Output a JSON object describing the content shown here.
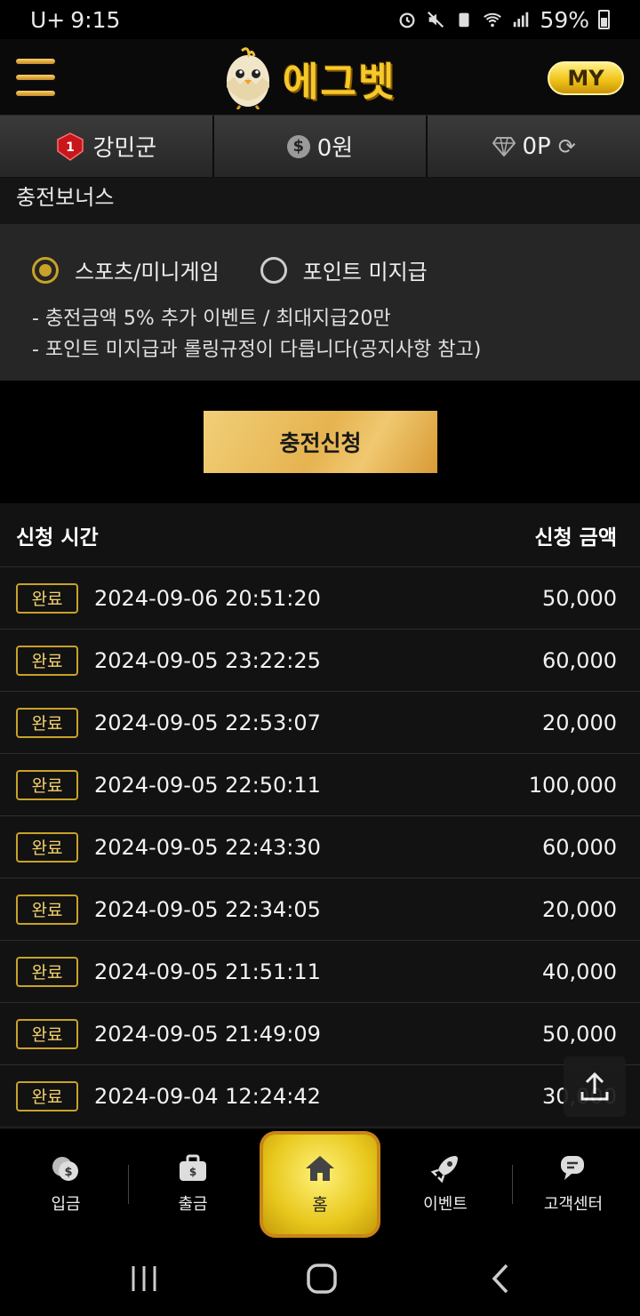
{
  "status_bar": {
    "carrier": "U+",
    "time": "9:15",
    "battery": "59%"
  },
  "header": {
    "logo_text": "에그벳",
    "my_label": "MY"
  },
  "user_bar": {
    "username": "강민군",
    "level": "1",
    "balance": "0원",
    "points": "0P"
  },
  "bonus": {
    "title": "충전보너스",
    "options": [
      {
        "label": "스포츠/미니게임",
        "selected": true
      },
      {
        "label": "포인트 미지급",
        "selected": false
      }
    ],
    "notes": [
      "- 충전금액 5% 추가 이벤트 / 최대지급20만",
      "- 포인트 미지급과 롤링규정이 다릅니다(공지사항 참고)"
    ]
  },
  "submit_label": "충전신청",
  "history": {
    "col_time": "신청 시간",
    "col_amount": "신청 금액",
    "rows": [
      {
        "status": "완료",
        "time": "2024-09-06 20:51:20",
        "amount": "50,000"
      },
      {
        "status": "완료",
        "time": "2024-09-05 23:22:25",
        "amount": "60,000"
      },
      {
        "status": "완료",
        "time": "2024-09-05 22:53:07",
        "amount": "20,000"
      },
      {
        "status": "완료",
        "time": "2024-09-05 22:50:11",
        "amount": "100,000"
      },
      {
        "status": "완료",
        "time": "2024-09-05 22:43:30",
        "amount": "60,000"
      },
      {
        "status": "완료",
        "time": "2024-09-05 22:34:05",
        "amount": "20,000"
      },
      {
        "status": "완료",
        "time": "2024-09-05 21:51:11",
        "amount": "40,000"
      },
      {
        "status": "완료",
        "time": "2024-09-05 21:49:09",
        "amount": "50,000"
      },
      {
        "status": "완료",
        "time": "2024-09-04 12:24:42",
        "amount": "30,000"
      }
    ]
  },
  "bottom_nav": {
    "deposit": "입금",
    "withdraw": "출금",
    "home": "홈",
    "event": "이벤트",
    "support": "고객센터"
  },
  "icons": {
    "menu": "hamburger-icon",
    "level": "level-badge-icon",
    "coin": "coin-icon",
    "diamond": "diamond-icon",
    "refresh": "refresh-icon",
    "scroll_top": "arrow-up-icon"
  },
  "colors": {
    "accent_gold": "#c9a227",
    "background": "#000000"
  }
}
